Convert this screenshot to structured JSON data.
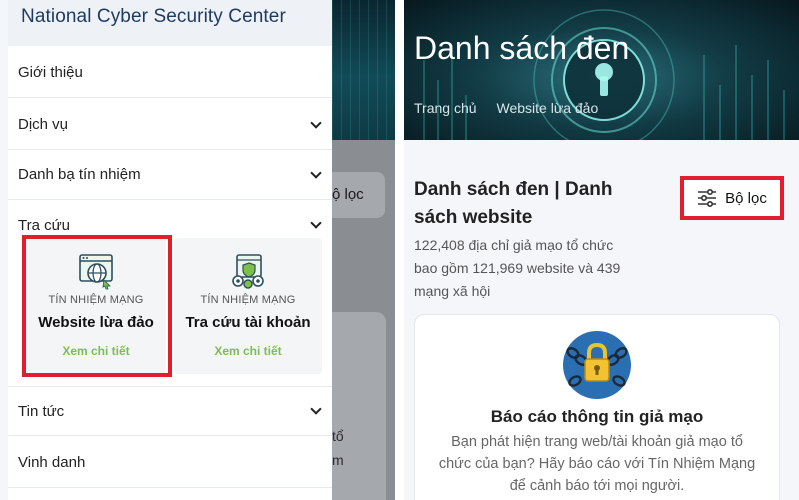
{
  "left_panel": {
    "header_title": "National Cyber Security Center",
    "menu": [
      {
        "label": "Giới thiệu",
        "has_chevron": false
      },
      {
        "label": "Dịch vụ",
        "has_chevron": true
      },
      {
        "label": "Danh bạ tín nhiệm",
        "has_chevron": true
      },
      {
        "label": "Tra cứu",
        "has_chevron": true
      },
      {
        "label": "Tin tức",
        "has_chevron": true
      },
      {
        "label": "Vinh danh",
        "has_chevron": false
      }
    ],
    "submenu": [
      {
        "tag": "TÍN NHIỆM MẠNG",
        "name": "Website lừa đảo",
        "link": "Xem chi tiết",
        "icon": "globe-window-icon"
      },
      {
        "tag": "TÍN NHIỆM MẠNG",
        "name": "Tra cứu tài khoản",
        "link": "Xem chi tiết",
        "icon": "shield-gears-icon"
      }
    ],
    "background_partial": {
      "filter_label": "ộ lọc",
      "text_fragments": [
        "tổ",
        "m"
      ]
    }
  },
  "right_panel": {
    "hero_title": "Danh sách đen",
    "breadcrumbs": [
      "Trang chủ",
      "Website lừa đảo"
    ],
    "list_title": "Danh sách đen | Danh sách website",
    "list_subtitle": "122,408 địa chỉ giả mạo tổ chức bao gồm 121,969 website và 439 mạng xã hội",
    "filter_label": "Bộ lọc",
    "report_card": {
      "title": "Báo cáo thông tin giả mạo",
      "text": "Bạn phát hiện trang web/tài khoản giả mạo tổ chức của bạn? Hãy báo cáo với Tín Nhiệm Mạng để cảnh báo tới mọi người.",
      "icon": "chain-padlock-icon"
    }
  },
  "colors": {
    "highlight": "#e11d2e",
    "link_green": "#7cc04b",
    "header_title": "#1e3a5f"
  }
}
